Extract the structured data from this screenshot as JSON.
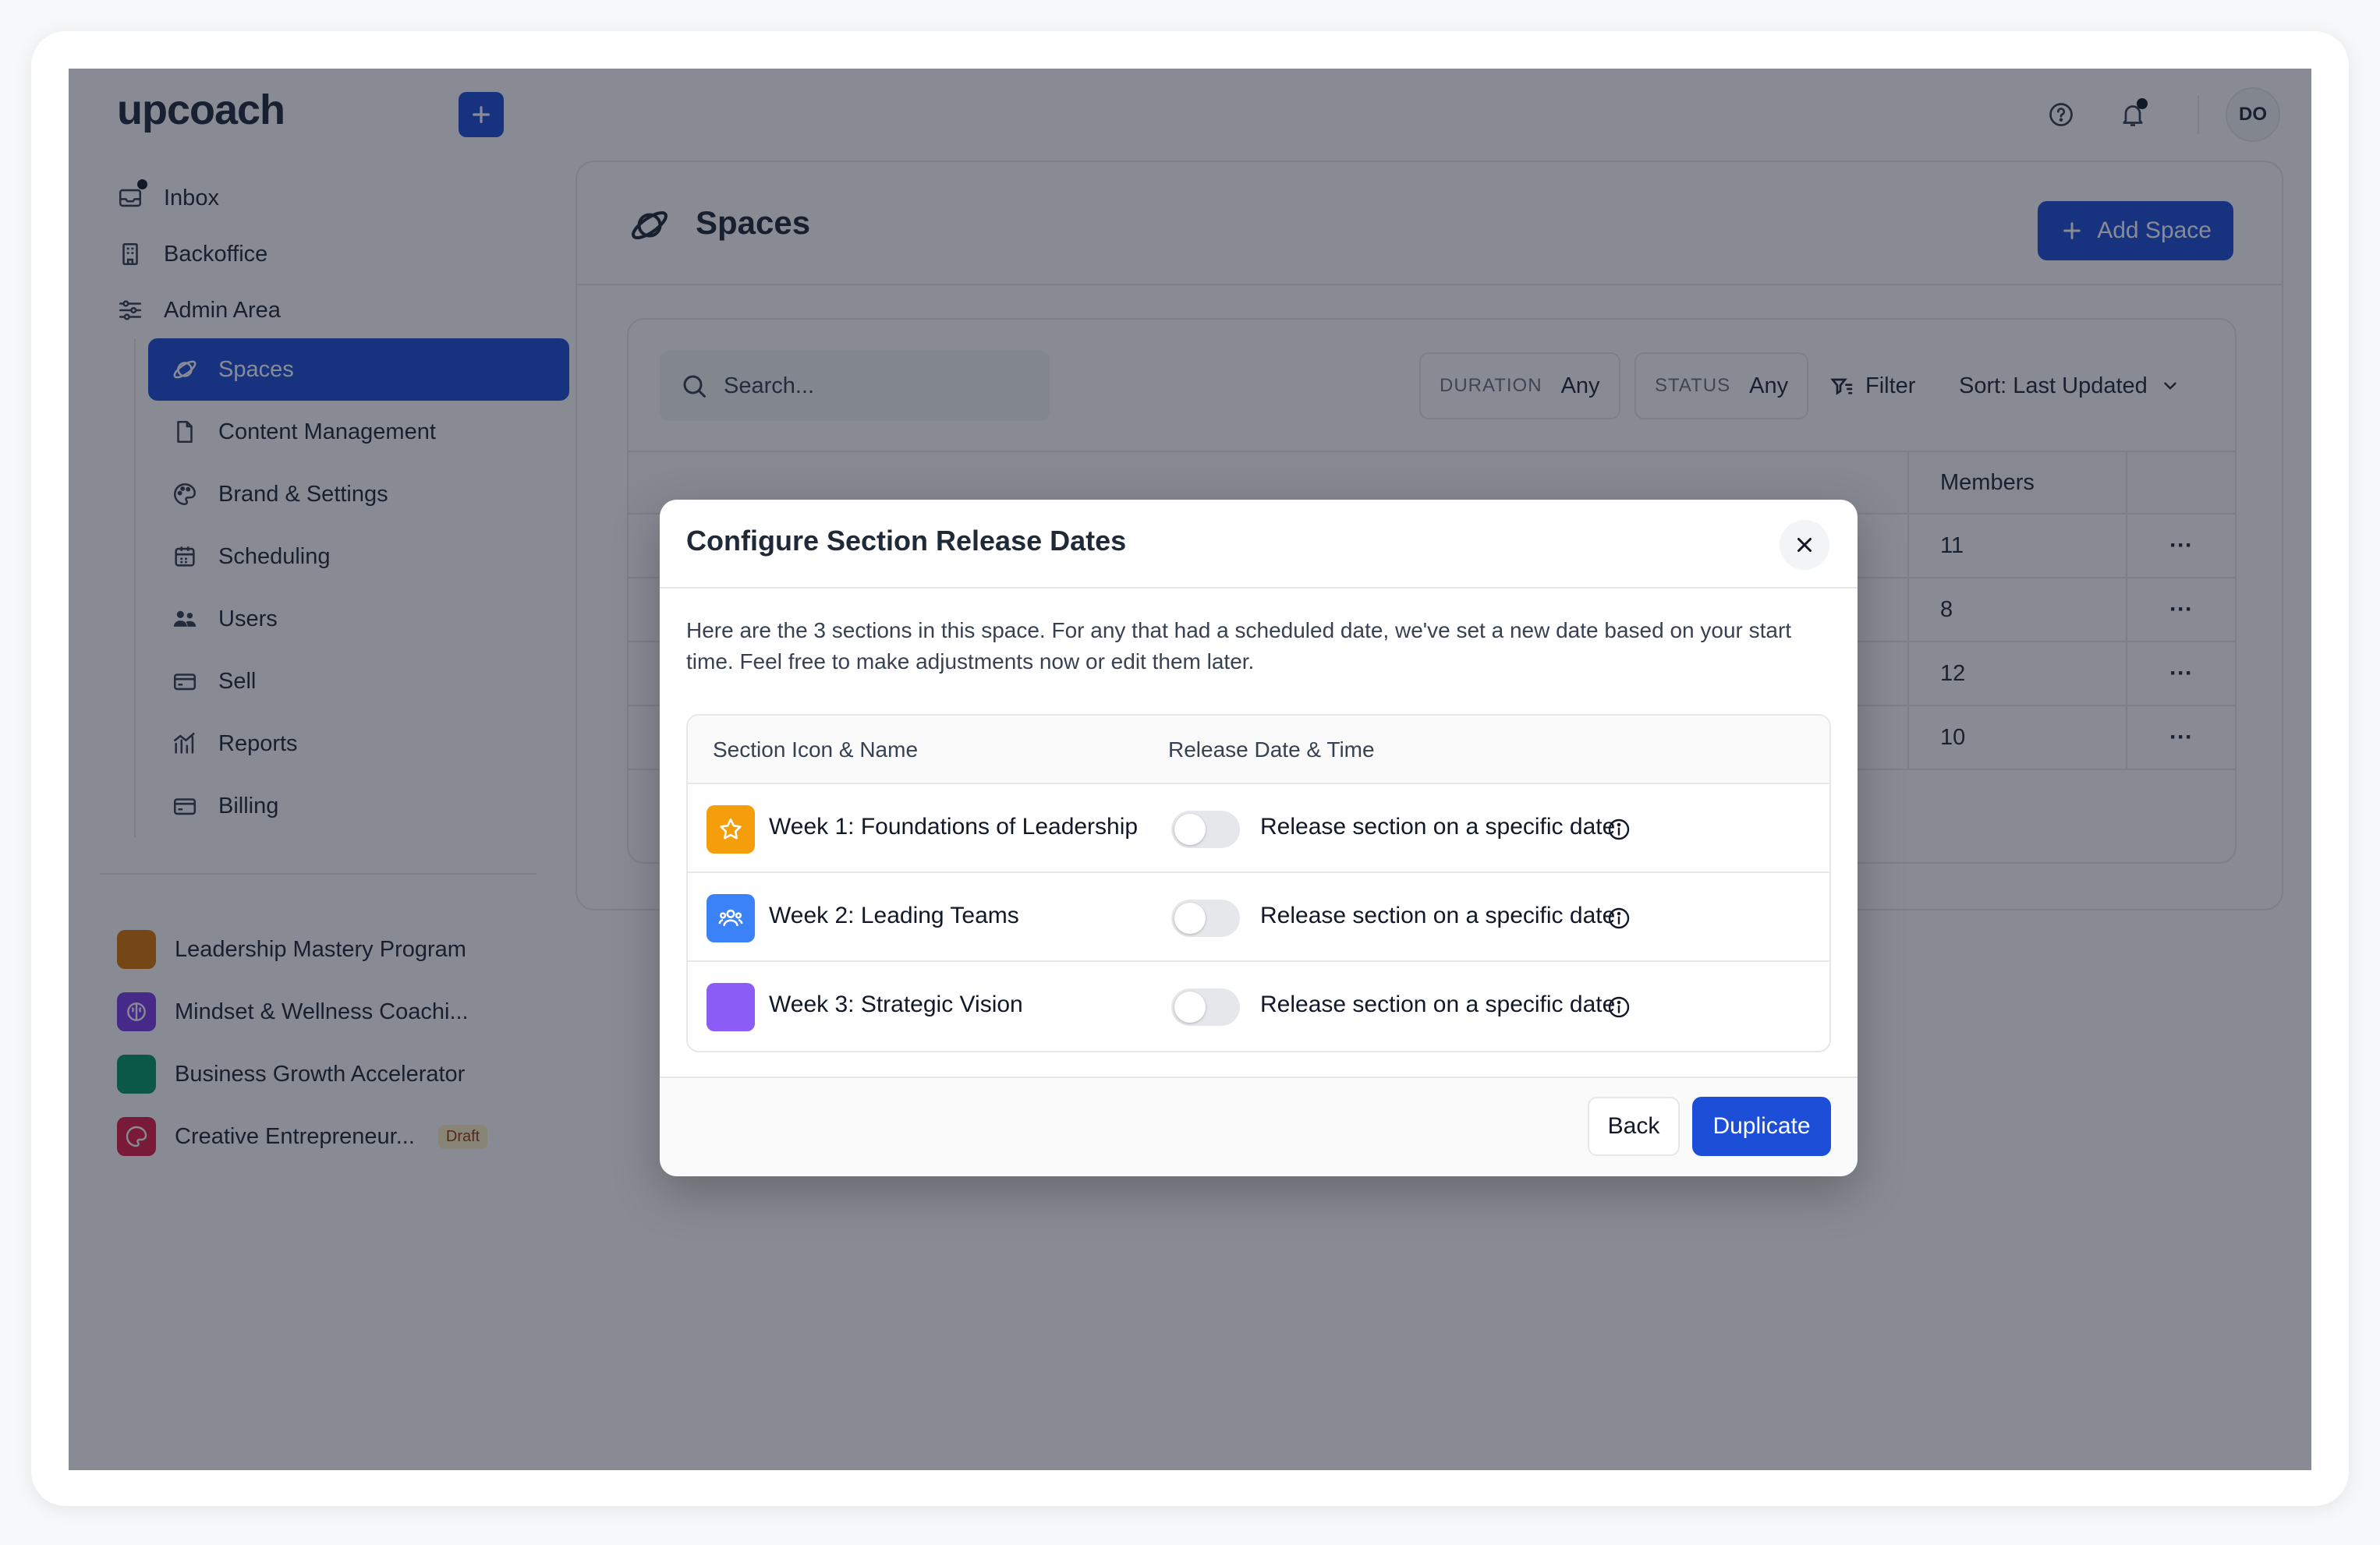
{
  "app": {
    "logo": "upcoach"
  },
  "header": {
    "avatar_initials": "DO"
  },
  "sidebar": {
    "nav": [
      {
        "label": "Inbox",
        "icon": "inbox-icon"
      },
      {
        "label": "Backoffice",
        "icon": "building-icon"
      },
      {
        "label": "Admin Area",
        "icon": "sliders-icon"
      }
    ],
    "admin_items": [
      {
        "label": "Spaces",
        "icon": "planet-icon",
        "active": true
      },
      {
        "label": "Content Management",
        "icon": "file-icon"
      },
      {
        "label": "Brand & Settings",
        "icon": "palette-icon"
      },
      {
        "label": "Scheduling",
        "icon": "calendar-icon"
      },
      {
        "label": "Users",
        "icon": "users-icon"
      },
      {
        "label": "Sell",
        "icon": "card-icon"
      },
      {
        "label": "Reports",
        "icon": "chart-icon"
      },
      {
        "label": "Billing",
        "icon": "card-icon"
      }
    ],
    "spaces": [
      {
        "label": "Leadership Mastery Program",
        "color": "#d97706"
      },
      {
        "label": "Mindset & Wellness Coachi...",
        "color": "#7c3aed"
      },
      {
        "label": "Business Growth Accelerator",
        "color": "#059669"
      },
      {
        "label": "Creative Entrepreneur...",
        "color": "#e11d48",
        "badge": "Draft"
      }
    ]
  },
  "main": {
    "title": "Spaces",
    "add_button": "Add Space",
    "search_placeholder": "Search...",
    "filters": {
      "duration_key": "DURATION",
      "duration_value": "Any",
      "status_key": "STATUS",
      "status_value": "Any",
      "filter_label": "Filter",
      "sort_label": "Sort: Last Updated"
    },
    "table": {
      "members_header": "Members",
      "rows": [
        {
          "members": "11"
        },
        {
          "members": "8"
        },
        {
          "members": "12"
        },
        {
          "members": "10"
        }
      ],
      "row_menu": "···"
    }
  },
  "modal": {
    "title": "Configure Section Release Dates",
    "description": "Here are the 3 sections in this space. For any that had a scheduled date, we've set a new date based on your start time. Feel free to make adjustments now or edit them later.",
    "col_name": "Section Icon & Name",
    "col_release": "Release Date & Time",
    "sections": [
      {
        "name": "Week 1: Foundations of Leadership",
        "icon": "star-icon",
        "color": "#f59e0b",
        "release_label": "Release section on a specific date",
        "enabled": false
      },
      {
        "name": "Week 2: Leading Teams",
        "icon": "users-icon",
        "color": "#3b82f6",
        "release_label": "Release section on a specific date",
        "enabled": false
      },
      {
        "name": "Week 3: Strategic Vision",
        "icon": "",
        "color": "#8b5cf6",
        "release_label": "Release section on a specific date",
        "enabled": false
      }
    ],
    "back_label": "Back",
    "duplicate_label": "Duplicate"
  },
  "colors": {
    "primary": "#1d4ed8",
    "overlay": "rgba(17,24,39,0.5)"
  }
}
